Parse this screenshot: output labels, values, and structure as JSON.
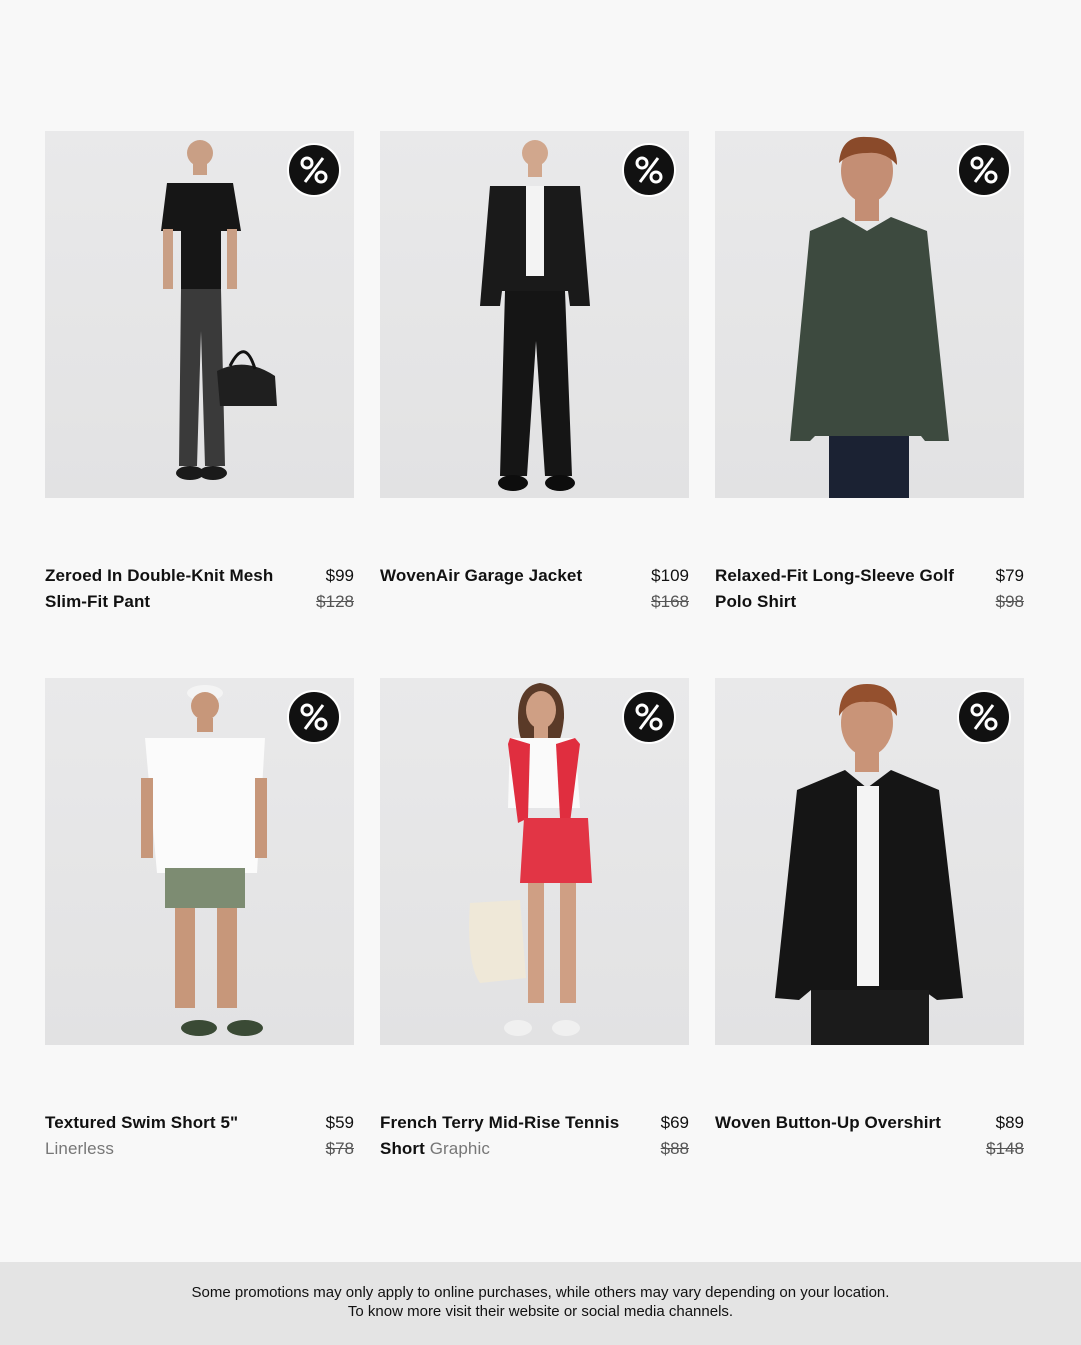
{
  "products": [
    {
      "name": "Zeroed In Double-Knit Mesh Slim-Fit Pant",
      "sub": "",
      "price": "$99",
      "was": "$128"
    },
    {
      "name": "WovenAir Garage Jacket",
      "sub": "",
      "price": "$109",
      "was": "$168"
    },
    {
      "name": "Relaxed-Fit Long-Sleeve Golf Polo Shirt",
      "sub": "",
      "price": "$79",
      "was": "$98"
    },
    {
      "name": "Textured Swim Short 5\"",
      "sub": "Linerless",
      "price": "$59",
      "was": "$78"
    },
    {
      "name": "French Terry Mid-Rise Tennis Short",
      "sub": "Graphic",
      "price": "$69",
      "was": "$88"
    },
    {
      "name": "Woven Button-Up Overshirt",
      "sub": "",
      "price": "$89",
      "was": "$148"
    }
  ],
  "badge_icon": "percent-icon",
  "footer": {
    "line1": "Some promotions may only apply to online purchases, while others may vary depending on your location.",
    "line2": "To know more visit their website or social media channels."
  }
}
